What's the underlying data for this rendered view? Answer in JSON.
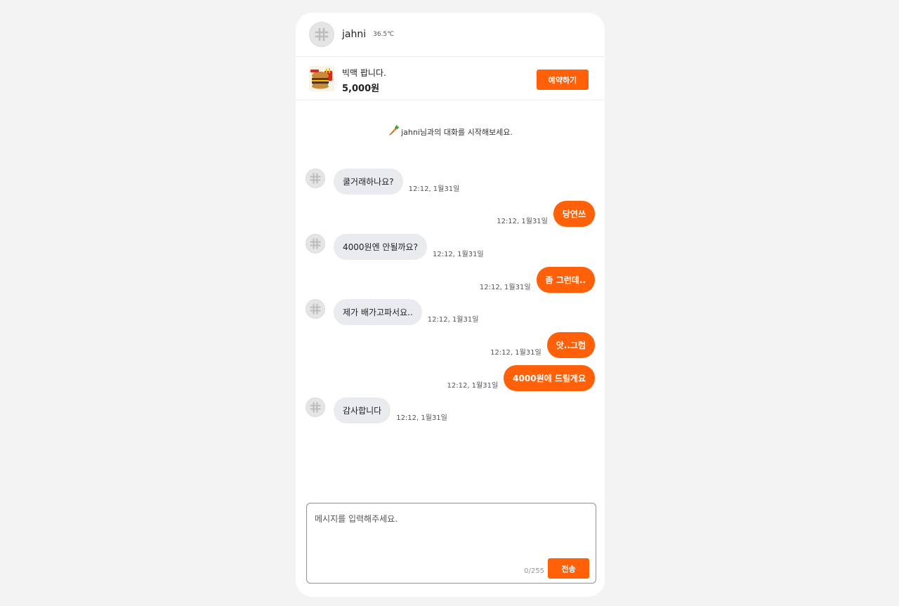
{
  "header": {
    "username": "jahni",
    "temperature": "36.5℃",
    "avatar_icon": "hash-icon"
  },
  "product": {
    "title": "빅맥 팝니다.",
    "price": "5,000원",
    "reserve_label": "예약하기",
    "thumbnail_icon": "burger-image"
  },
  "intro": {
    "text": "jahni님과의 대화를 시작해보세요.",
    "icon": "carrot-icon"
  },
  "messages": [
    {
      "direction": "in",
      "text": "쿨거래하나요?",
      "time": "12:12, 1월31일"
    },
    {
      "direction": "out",
      "text": "당연쓰",
      "time": "12:12, 1월31일"
    },
    {
      "direction": "in",
      "text": "4000원엔 안될까요?",
      "time": "12:12, 1월31일"
    },
    {
      "direction": "out",
      "text": "좀 그런데..",
      "time": "12:12, 1월31일"
    },
    {
      "direction": "in",
      "text": "제가 배가고파서요..",
      "time": "12:12, 1월31일"
    },
    {
      "direction": "out",
      "text": "앗..그럼",
      "time": "12:12, 1월31일"
    },
    {
      "direction": "out",
      "text": "4000원에 드릴게요",
      "time": "12:12, 1월31일"
    },
    {
      "direction": "in",
      "text": "감사합니다",
      "time": "12:12, 1월31일"
    }
  ],
  "composer": {
    "placeholder": "메시지를 입력해주세요.",
    "counter": "0/255",
    "send_label": "전송"
  },
  "colors": {
    "accent": "#ff6008",
    "incoming_bubble": "#eaebef",
    "background": "#f3f3f3"
  }
}
